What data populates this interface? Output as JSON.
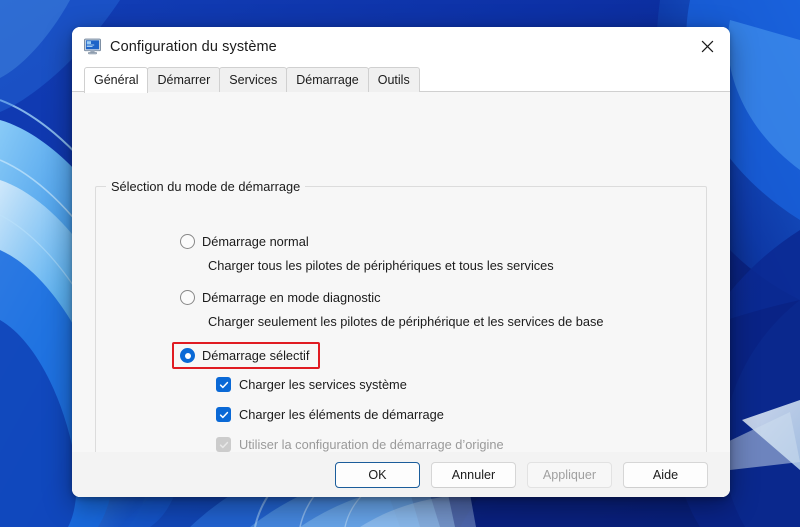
{
  "desktop": {
    "wallpaper_name": "windows-11-bloom-wallpaper",
    "colors": {
      "deep_blue": "#0b2fa0",
      "mid_blue": "#1560d8",
      "light_blue": "#69b8f0",
      "pale": "#dfe9f5",
      "navy": "#071a5e"
    }
  },
  "dialog": {
    "title": "Configuration du système",
    "icon": "system-configuration-icon",
    "close_label": "×",
    "tabs": [
      {
        "label": "Général",
        "active": true
      },
      {
        "label": "Démarrer",
        "active": false
      },
      {
        "label": "Services",
        "active": false
      },
      {
        "label": "Démarrage",
        "active": false
      },
      {
        "label": "Outils",
        "active": false
      }
    ],
    "groupbox": {
      "title": "Sélection du mode de démarrage",
      "radios": [
        {
          "label": "Démarrage normal",
          "description": "Charger tous les pilotes de périphériques et tous les services",
          "checked": false,
          "highlighted": false
        },
        {
          "label": "Démarrage en mode diagnostic",
          "description": "Charger seulement les pilotes de périphérique et les services de base",
          "checked": false,
          "highlighted": false
        },
        {
          "label": "Démarrage sélectif",
          "description": "",
          "checked": true,
          "highlighted": true
        }
      ],
      "checkboxes": [
        {
          "label": "Charger les services système",
          "checked": true,
          "disabled": false
        },
        {
          "label": "Charger les éléments de démarrage",
          "checked": true,
          "disabled": false
        },
        {
          "label": "Utiliser la configuration de démarrage d’origine",
          "checked": true,
          "disabled": true
        }
      ]
    },
    "buttons": [
      {
        "label": "OK",
        "state": "focused"
      },
      {
        "label": "Annuler",
        "state": "normal"
      },
      {
        "label": "Appliquer",
        "state": "disabled"
      },
      {
        "label": "Aide",
        "state": "normal"
      }
    ],
    "accent_color": "#0a69d6",
    "highlight_color": "#e01b22"
  }
}
